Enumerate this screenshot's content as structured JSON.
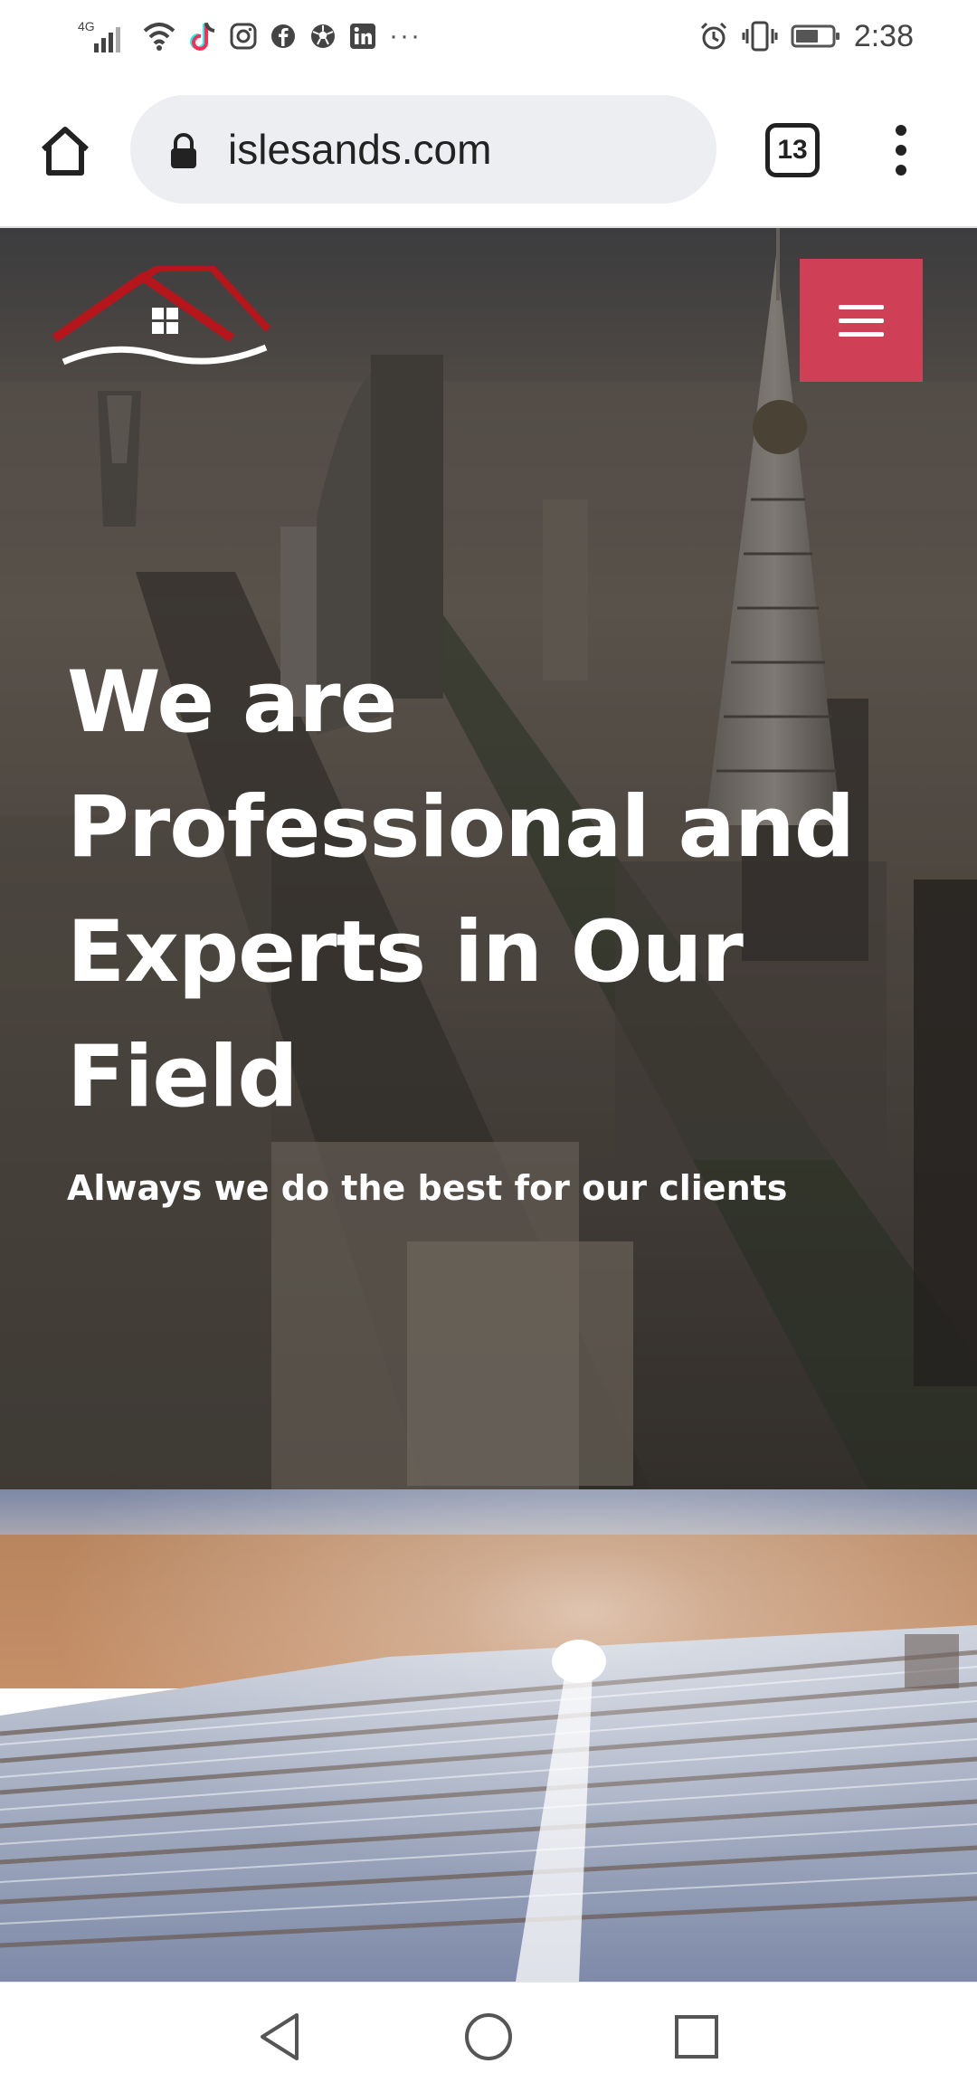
{
  "status_bar": {
    "network": "4G",
    "time": "2:38",
    "icons": [
      "signal-icon",
      "wifi-icon",
      "tiktok-icon",
      "instagram-icon",
      "facebook-icon",
      "football-icon",
      "linkedin-icon",
      "more-notifications-icon",
      "alarm-icon",
      "vibrate-icon",
      "battery-icon"
    ],
    "more": "···"
  },
  "browser": {
    "url": "islesands.com",
    "tab_count": "13"
  },
  "hero": {
    "title": "We are Professional and Experts in Our Field",
    "subtitle": "Always we do the best for our clients",
    "menu_button_color": "#cf4057",
    "logo_roof_color": "#b5161b"
  },
  "nav": {
    "buttons": [
      "back-icon",
      "home-icon",
      "recents-icon"
    ]
  }
}
